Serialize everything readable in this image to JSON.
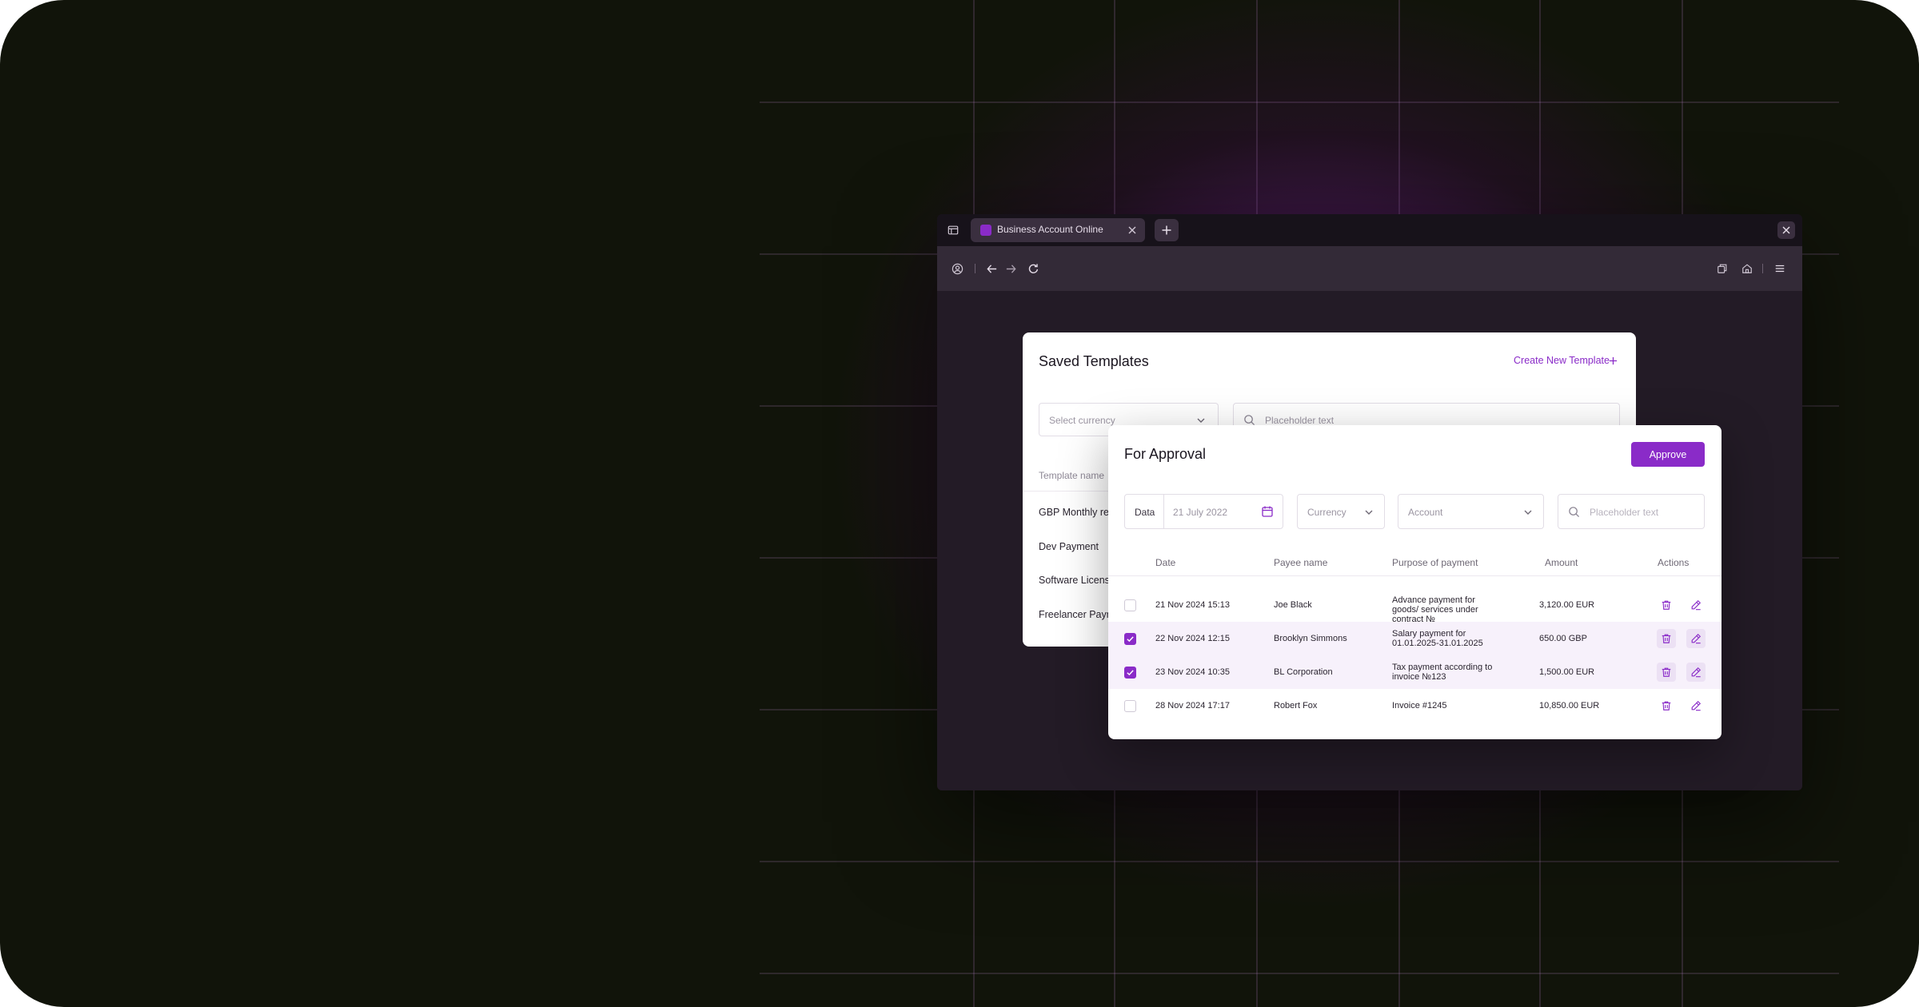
{
  "colors": {
    "accent": "#8a2bc8",
    "page_background": "#11140a",
    "glow": "#a028be"
  },
  "browser": {
    "tab_title": "Business Account Online",
    "icons": [
      "sidebar-icon",
      "favicon-icon",
      "close-icon",
      "plus-icon",
      "window-close-icon",
      "profile-icon",
      "back-arrow-icon",
      "forward-arrow-icon",
      "reload-icon",
      "tabs-icon",
      "home-icon",
      "menu-icon"
    ]
  },
  "saved_templates": {
    "title": "Saved Templates",
    "create_label": "Create New Template",
    "currency_placeholder": "Select currency",
    "search_placeholder": "Placeholder text",
    "column_header": "Template name",
    "rows": [
      "GBP Monthly ren",
      "Dev Payment",
      "Software License",
      "Freelancer Paym"
    ]
  },
  "approval": {
    "title": "For Approval",
    "approve_label": "Approve",
    "filters": {
      "date_label": "Data",
      "date_value": "21 July 2022",
      "currency_placeholder": "Currency",
      "account_placeholder": "Account",
      "search_placeholder": "Placeholder text"
    },
    "columns": [
      "Date",
      "Payee name",
      "Purpose of payment",
      "Amount",
      "Actions"
    ],
    "rows": [
      {
        "selected": false,
        "date": "21 Nov 2024  15:13",
        "payee": "Joe Black",
        "purpose": "Advance payment for goods/ services under contract №",
        "amount": "3,120.00 EUR"
      },
      {
        "selected": true,
        "date": "22 Nov 2024  12:15",
        "payee": "Brooklyn Simmons",
        "purpose": "Salary payment for 01.01.2025-31.01.2025",
        "amount": "650.00 GBP"
      },
      {
        "selected": true,
        "date": "23 Nov 2024  10:35",
        "payee": "BL Corporation",
        "purpose": "Tax payment according to invoice №123",
        "amount": "1,500.00 EUR"
      },
      {
        "selected": false,
        "date": "28 Nov 2024  17:17",
        "payee": "Robert Fox",
        "purpose": "Invoice #1245",
        "amount": "10,850.00 EUR"
      }
    ],
    "row_icons": [
      "checkbox",
      "trash-icon",
      "edit-pencil-icon"
    ]
  }
}
